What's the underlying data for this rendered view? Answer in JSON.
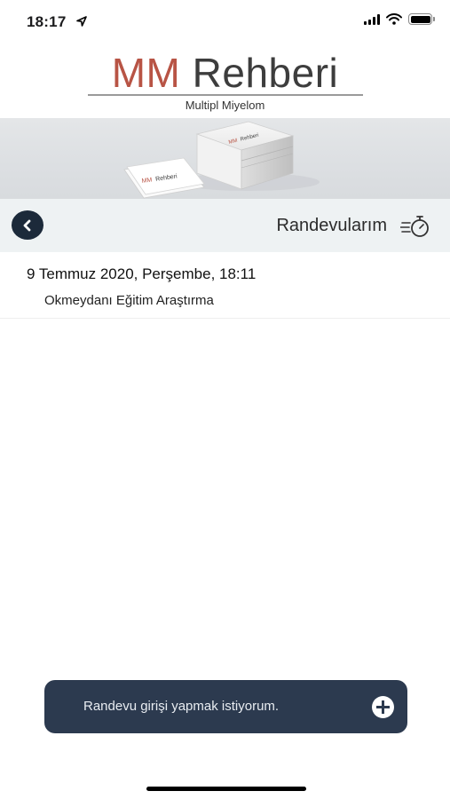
{
  "status_bar": {
    "time": "18:17",
    "icons": [
      "location-arrow-icon",
      "cellular-signal-icon",
      "wifi-icon",
      "battery-icon"
    ]
  },
  "logo": {
    "brand_mm": "MM",
    "brand_rest": "Rehberi",
    "subtitle": "Multipl Miyelom",
    "colors": {
      "mm": "#b85445",
      "rest": "#3d3d3d"
    }
  },
  "banner": {
    "card_brand_mm": "MM",
    "card_brand_rest": "Rehberi"
  },
  "navbar": {
    "back_icon": "chevron-left-icon",
    "title": "Randevularım",
    "title_icon": "stopwatch-icon"
  },
  "appointments": [
    {
      "date": "9 Temmuz 2020, Perşembe, 18:11",
      "place": "Okmeydanı Eğitim Araştırma"
    }
  ],
  "action": {
    "label": "Randevu girişi yapmak istiyorum.",
    "icon": "plus-icon",
    "color": "#2c3a4f"
  }
}
